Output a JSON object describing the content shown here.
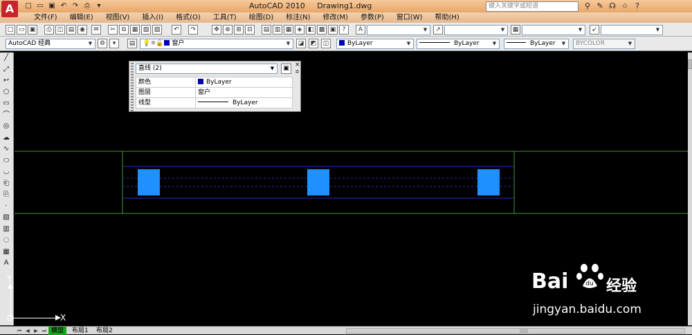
{
  "titlebar": {
    "app": "AutoCAD 2010",
    "doc": "Drawing1.dwg",
    "search_placeholder": "键入关键字或短语",
    "logo_letter": "A"
  },
  "menu": [
    "文件(F)",
    "编辑(E)",
    "视图(V)",
    "插入(I)",
    "格式(O)",
    "工具(T)",
    "绘图(D)",
    "标注(N)",
    "修改(M)",
    "参数(P)",
    "窗口(W)",
    "帮助(H)"
  ],
  "workspace": {
    "value": "AutoCAD 经典"
  },
  "layer": {
    "value": "窗户"
  },
  "properties": {
    "color": "ByLayer",
    "linetype": "ByLayer",
    "lineweight": "ByLayer",
    "plotstyle": "BYCOLOR"
  },
  "quick_properties": {
    "selection": "直线 (2)",
    "rows": [
      {
        "key": "颜色",
        "value": "ByLayer",
        "swatch": "#0000b0"
      },
      {
        "key": "图层",
        "value": "窗户"
      },
      {
        "key": "线型",
        "value": "ByLayer"
      }
    ]
  },
  "ucs": {
    "y": "Y",
    "x": "X"
  },
  "tabs": [
    "模型",
    "布局1",
    "布局2"
  ],
  "watermark": {
    "brand": "Bai",
    "cn": "经验",
    "url": "jingyan.baidu.com"
  },
  "colors": {
    "canvas": "#000000",
    "wall_line": "#3c9a3c",
    "window_line": "#2b2bb4",
    "column_fill": "#1e90ff",
    "active_tab": "#1ea11e"
  }
}
